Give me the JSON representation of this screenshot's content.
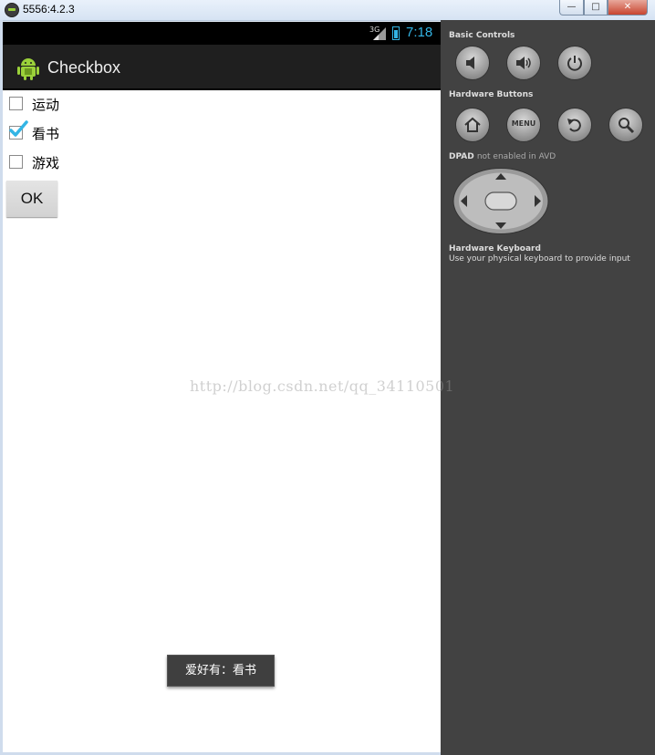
{
  "window": {
    "title": "5556:4.2.3",
    "min_label": "—",
    "max_label": "□",
    "close_label": "✕"
  },
  "status_bar": {
    "network": "3G",
    "time": "7:18"
  },
  "action_bar": {
    "title": "Checkbox",
    "icon": "android-icon"
  },
  "checkboxes": [
    {
      "label": "运动",
      "checked": false
    },
    {
      "label": "看书",
      "checked": true
    },
    {
      "label": "游戏",
      "checked": false
    }
  ],
  "ok_button": "OK",
  "toast": "爱好有：看书",
  "panel": {
    "basic_controls": "Basic Controls",
    "hardware_buttons": "Hardware Buttons",
    "menu_label": "MENU",
    "dpad_title": "DPAD",
    "dpad_status": "not enabled in AVD",
    "keyboard_title": "Hardware Keyboard",
    "keyboard_hint": "Use your physical keyboard to provide input"
  },
  "watermark": "http://blog.csdn.net/qq_34110501",
  "colors": {
    "accent": "#33b5e5",
    "panel_bg": "#424242",
    "action_bar_bg": "#1f1f1f"
  }
}
